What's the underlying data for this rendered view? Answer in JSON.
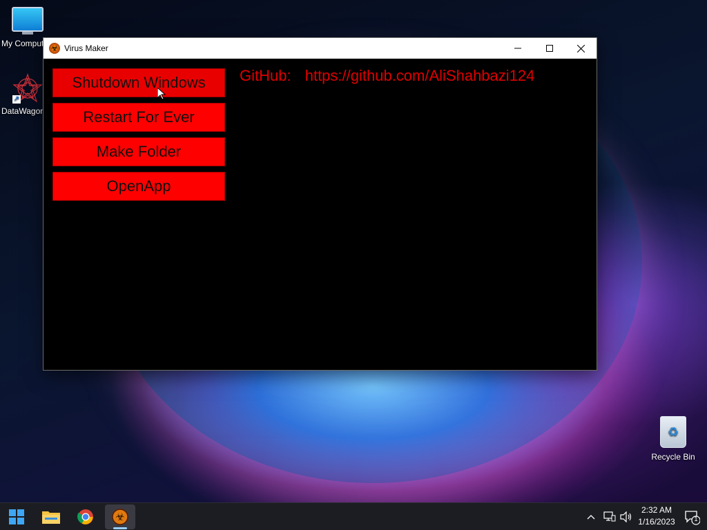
{
  "desktop": {
    "icons": [
      {
        "label": "My Comput",
        "icon": "monitor-icon"
      },
      {
        "label": "DataWagon",
        "icon": "datawagon-icon"
      },
      {
        "label": "Recycle Bin",
        "icon": "recycle-bin-icon"
      }
    ]
  },
  "window": {
    "title": "Virus Maker",
    "app_icon": "biohazard-icon",
    "controls": {
      "minimize": "—",
      "maximize": "□",
      "close": "✕"
    },
    "buttons": [
      {
        "label": "Shutdown Windows"
      },
      {
        "label": "Restart For Ever"
      },
      {
        "label": "Make Folder"
      },
      {
        "label": "OpenApp"
      }
    ],
    "github_label": "GitHub:",
    "github_url": "https://github.com/AliShahbazi124",
    "accent_color": "#ff0000",
    "background_color": "#000000"
  },
  "taskbar": {
    "pinned": [
      "windows-start-icon",
      "file-explorer-icon",
      "chrome-icon",
      "virus-maker-icon"
    ],
    "tray_icons": [
      "chevron-up-icon",
      "network-icon",
      "volume-icon",
      "notification-icon"
    ],
    "time": "2:32 AM",
    "date": "1/16/2023",
    "notification_count": "1"
  }
}
